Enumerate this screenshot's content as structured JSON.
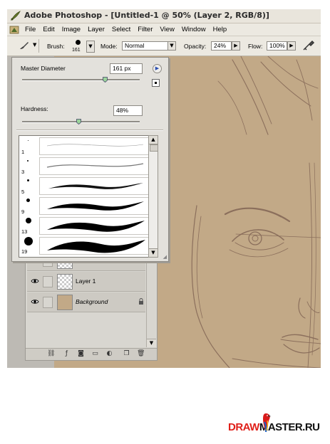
{
  "window": {
    "title": "Adobe Photoshop - [Untitled-1 @ 50% (Layer 2, RGB/8)]"
  },
  "menu": [
    "File",
    "Edit",
    "Image",
    "Layer",
    "Select",
    "Filter",
    "View",
    "Window",
    "Help"
  ],
  "options_bar": {
    "brush_label": "Brush:",
    "brush_size": "161",
    "mode_label": "Mode:",
    "mode_value": "Normal",
    "opacity_label": "Opacity:",
    "opacity_value": "24%",
    "flow_label": "Flow:",
    "flow_value": "100%"
  },
  "brush_popup": {
    "master_diameter_label": "Master Diameter",
    "master_diameter_value": "161 px",
    "master_diameter_fraction": 0.7,
    "hardness_label": "Hardness:",
    "hardness_value": "48%",
    "hardness_fraction": 0.48,
    "presets": [
      {
        "size": "1"
      },
      {
        "size": "3"
      },
      {
        "size": "5"
      },
      {
        "size": "9"
      },
      {
        "size": "13"
      },
      {
        "size": "19"
      }
    ]
  },
  "layers": [
    {
      "name": "",
      "thumb": "transparent"
    },
    {
      "name": "Layer 1",
      "thumb": "transparent"
    },
    {
      "name": "Background",
      "thumb": "tan",
      "locked": true
    }
  ],
  "icons": {
    "eye": "eye-icon",
    "lock": "lock-icon",
    "brush": "brush-icon",
    "airbrush": "airbrush-icon"
  },
  "colors": {
    "canvas": "#c2a987",
    "sketch": "#8b6f5c",
    "logo_red": "#e0201a",
    "logo_black": "#111111"
  },
  "logo": {
    "text_part1": "DRAW",
    "text_part2": "MASTER.RU"
  }
}
